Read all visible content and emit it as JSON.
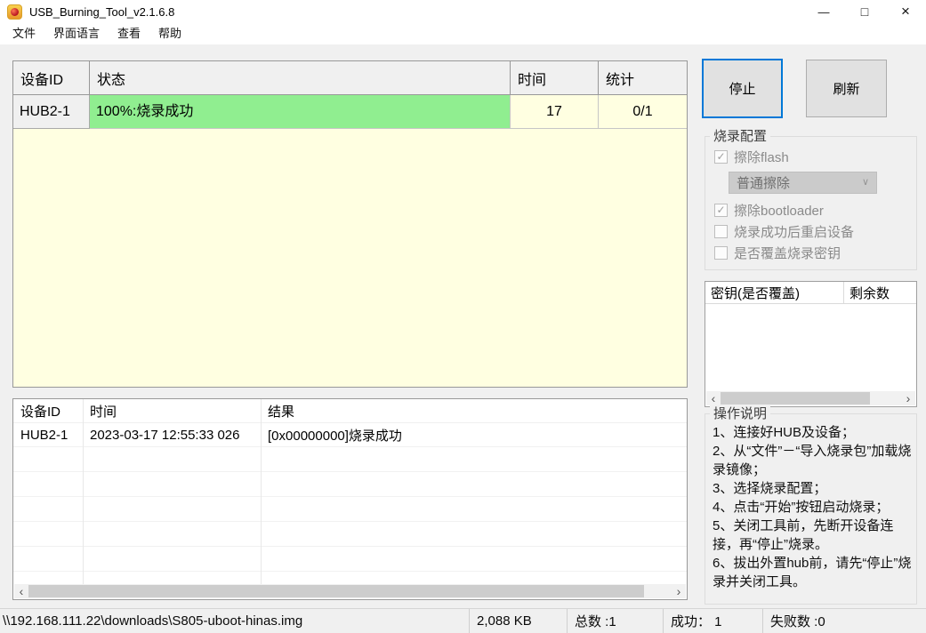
{
  "window": {
    "title": "USB_Burning_Tool_v2.1.6.8"
  },
  "icons": {
    "minimize": "—",
    "maximize": "□",
    "close": "×",
    "scroll_left": "‹",
    "scroll_right": "›",
    "dropdown_chevron": "∨",
    "check": "✓"
  },
  "menu": {
    "items": [
      {
        "label": "文件"
      },
      {
        "label": "界面语言"
      },
      {
        "label": "查看"
      },
      {
        "label": "帮助"
      }
    ]
  },
  "device_table": {
    "headers": {
      "device_id": "设备ID",
      "status": "状态",
      "time": "时间",
      "stats": "统计"
    },
    "rows": [
      {
        "device_id": "HUB2-1",
        "status": "100%:烧录成功",
        "time": "17",
        "stats": "0/1",
        "progress_percent": 100
      }
    ]
  },
  "actions": {
    "stop": "停止",
    "refresh": "刷新"
  },
  "burn_config": {
    "title": "烧录配置",
    "options": [
      {
        "label": "擦除flash",
        "checked": true
      },
      {
        "label": "擦除bootloader",
        "checked": true
      },
      {
        "label": "烧录成功后重启设备",
        "checked": false
      },
      {
        "label": "是否覆盖烧录密钥",
        "checked": false
      }
    ],
    "erase_mode": "普通擦除"
  },
  "key_table": {
    "headers": {
      "key": "密钥(是否覆盖)",
      "remaining": "剩余数"
    },
    "rows": []
  },
  "instructions": {
    "title": "操作说明",
    "lines": [
      "1、连接好HUB及设备；",
      "2、从“文件”－“导入烧录包”加载烧录镜像；",
      "3、选择烧录配置；",
      "4、点击“开始”按钮启动烧录；",
      "5、关闭工具前，先断开设备连接，再“停止”烧录。",
      "6、拔出外置hub前，请先“停止”烧录并关闭工具。"
    ]
  },
  "log_table": {
    "headers": {
      "device_id": "设备ID",
      "time": "时间",
      "result": "结果"
    },
    "rows": [
      {
        "device_id": "HUB2-1",
        "time": "2023-03-17 12:55:33 026",
        "result": "[0x00000000]烧录成功"
      }
    ]
  },
  "status_bar": {
    "file_path": "\\\\192.168.111.22\\downloads\\S805-uboot-hinas.img",
    "file_size": "2,088 KB",
    "total": "总数 :1",
    "success": "成功： 1",
    "failed": "失败数 :0"
  },
  "colors": {
    "accent_blue": "#0078D7",
    "progress_green": "#90EE90",
    "table_background": "#FFFFE1",
    "button_face": "#E1E1E1"
  }
}
